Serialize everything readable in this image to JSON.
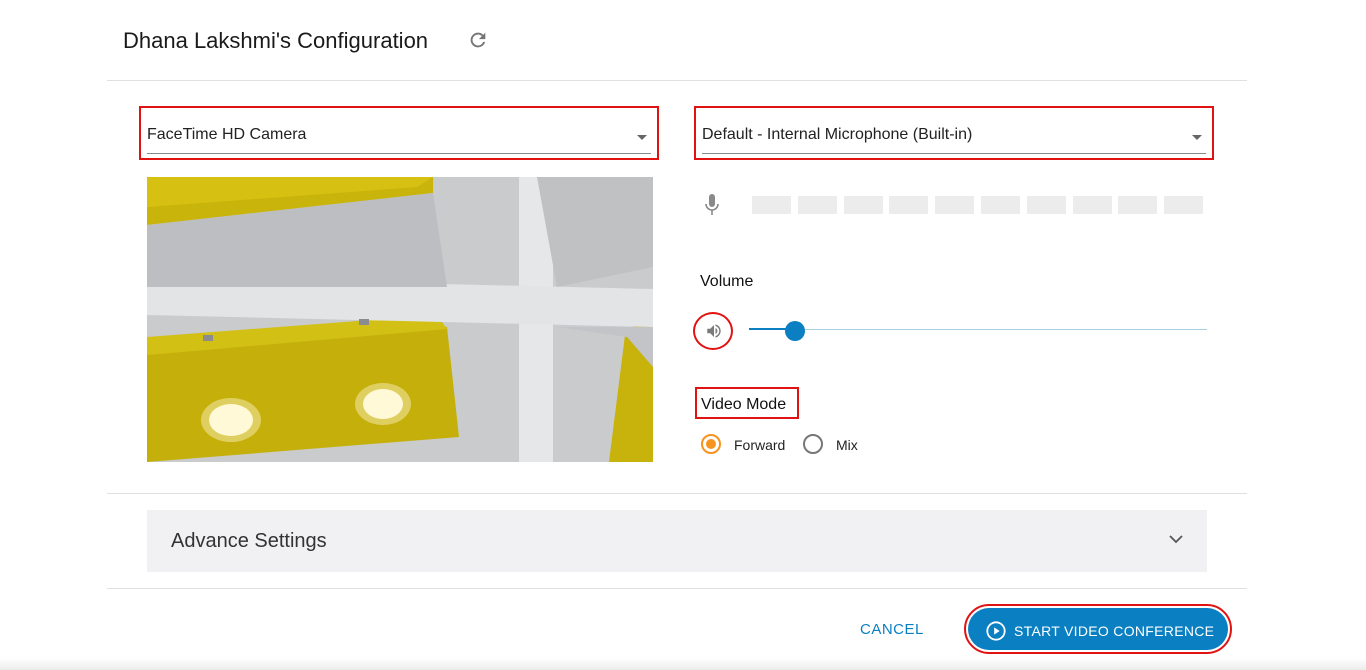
{
  "header": {
    "title": "Dhana Lakshmi's Configuration"
  },
  "camera": {
    "selected": "FaceTime HD Camera"
  },
  "microphone": {
    "selected": "Default - Internal Microphone (Built-in)",
    "meter_segments": 10,
    "meter_level": 0
  },
  "volume": {
    "label": "Volume",
    "value": 0.1
  },
  "video_mode": {
    "label": "Video Mode",
    "options": [
      {
        "label": "Forward",
        "selected": true
      },
      {
        "label": "Mix",
        "selected": false
      }
    ]
  },
  "advance": {
    "label": "Advance Settings"
  },
  "actions": {
    "cancel": "CANCEL",
    "start": "START VIDEO CONFERENCE"
  },
  "colors": {
    "primary": "#0a7fc2",
    "accent": "#f7941d",
    "highlight": "#e01212"
  }
}
